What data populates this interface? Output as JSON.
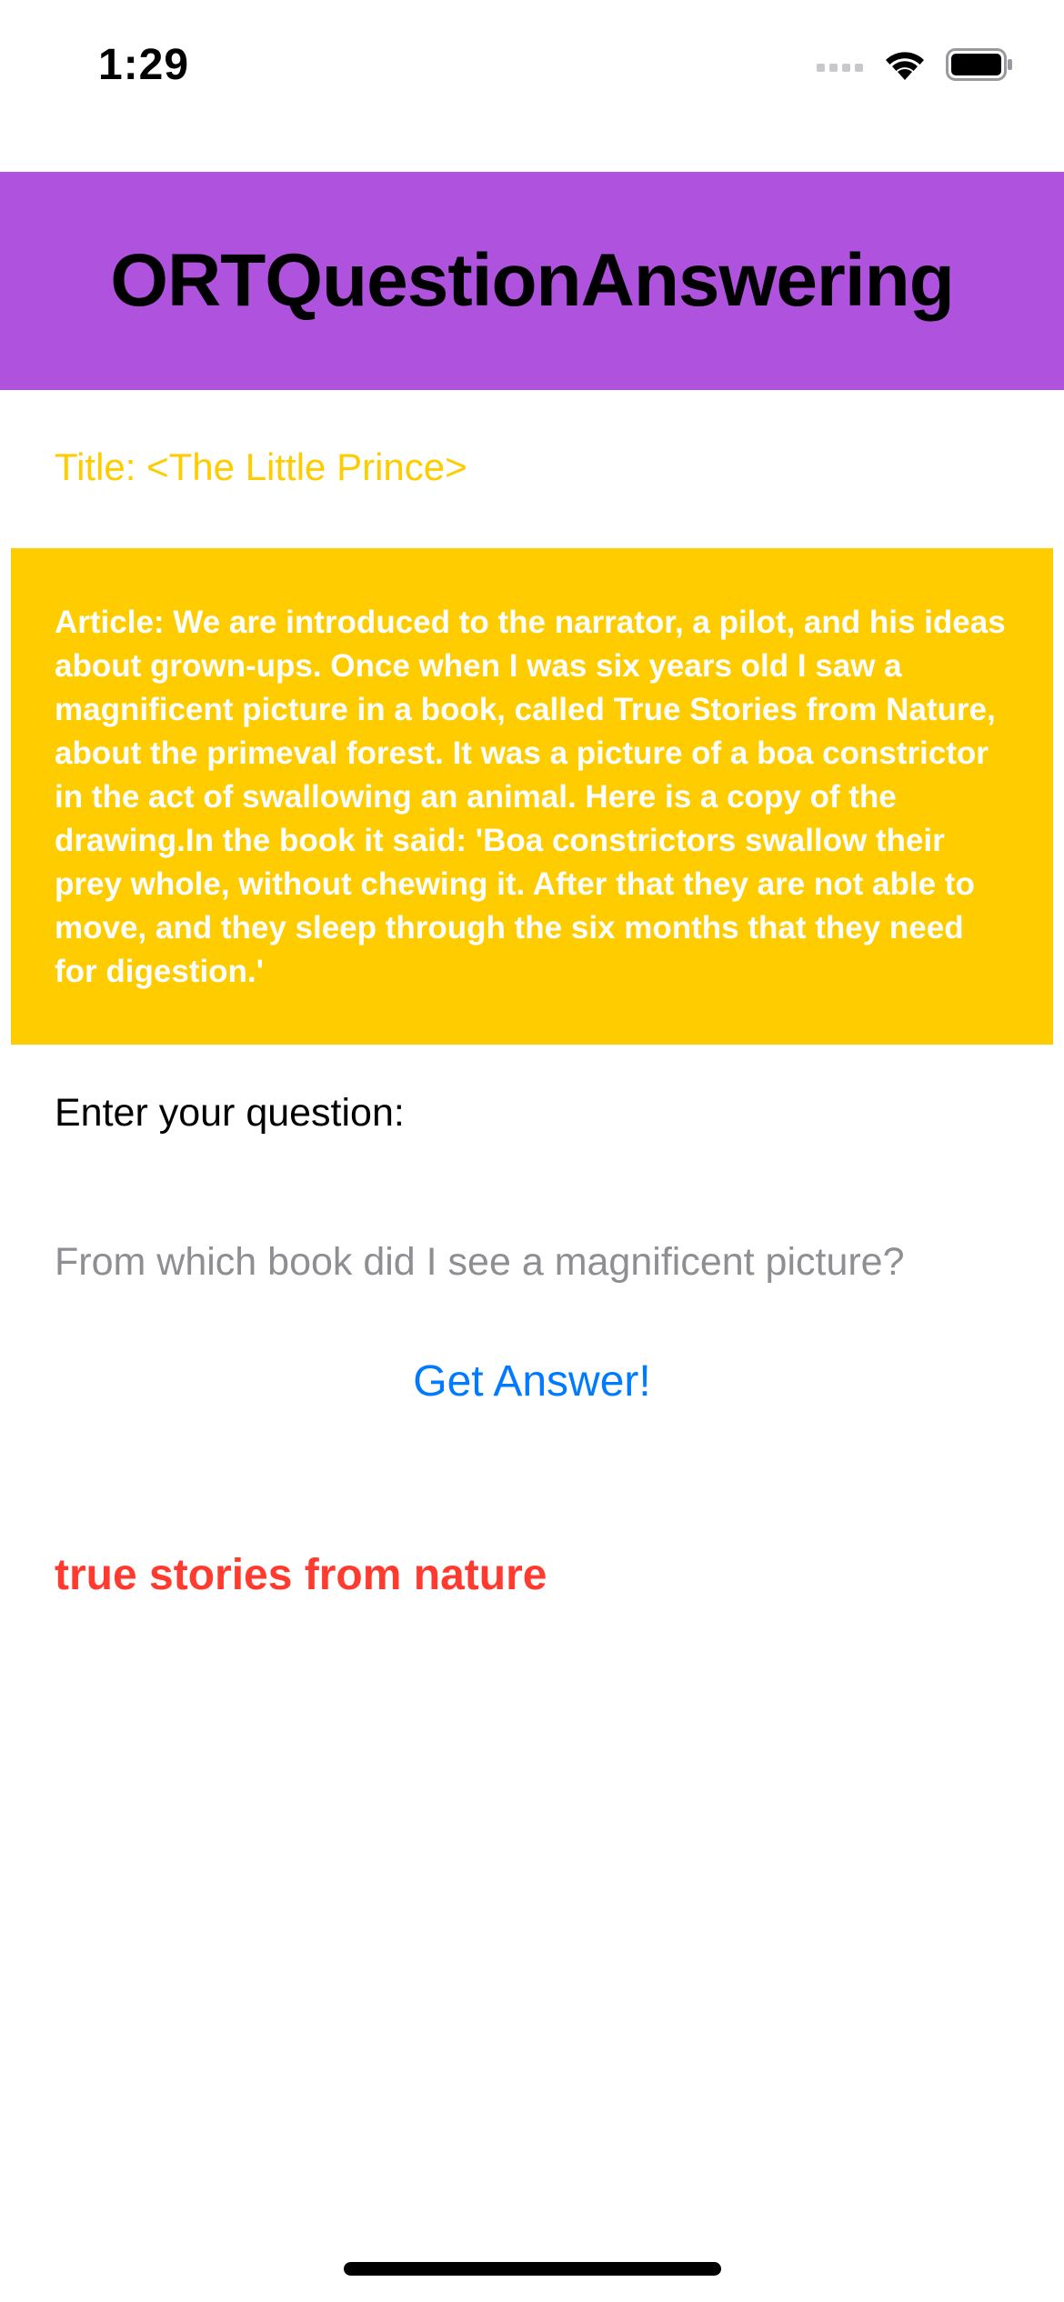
{
  "status_bar": {
    "time": "1:29",
    "icons": [
      "cellular-signal-icon",
      "wifi-icon",
      "battery-icon"
    ]
  },
  "header": {
    "title": "ORTQuestionAnswering",
    "background_color": "#af52de"
  },
  "title_label": {
    "text": "Title: <The Little Prince>",
    "color": "#ffcc00"
  },
  "article": {
    "text": "Article: We are introduced to the narrator, a pilot, and his ideas about grown-ups. Once when I was six years old I saw a magnificent picture in a book, called True Stories from Nature, about the primeval forest. It was a picture of a boa constrictor in the act of swallowing an animal. Here is a copy of the drawing.In the book it said: 'Boa constrictors swallow their prey whole, without chewing it. After that they are not able to move, and they sleep through the six months that they need for digestion.'",
    "background_color": "#ffcc00"
  },
  "question": {
    "label": "Enter your question:",
    "placeholder": "From which book did I see a magnificent picture?",
    "value": ""
  },
  "button": {
    "label": "Get Answer!",
    "color": "#007aff"
  },
  "answer": {
    "text": "true stories from nature",
    "color": "#ff3b30"
  }
}
